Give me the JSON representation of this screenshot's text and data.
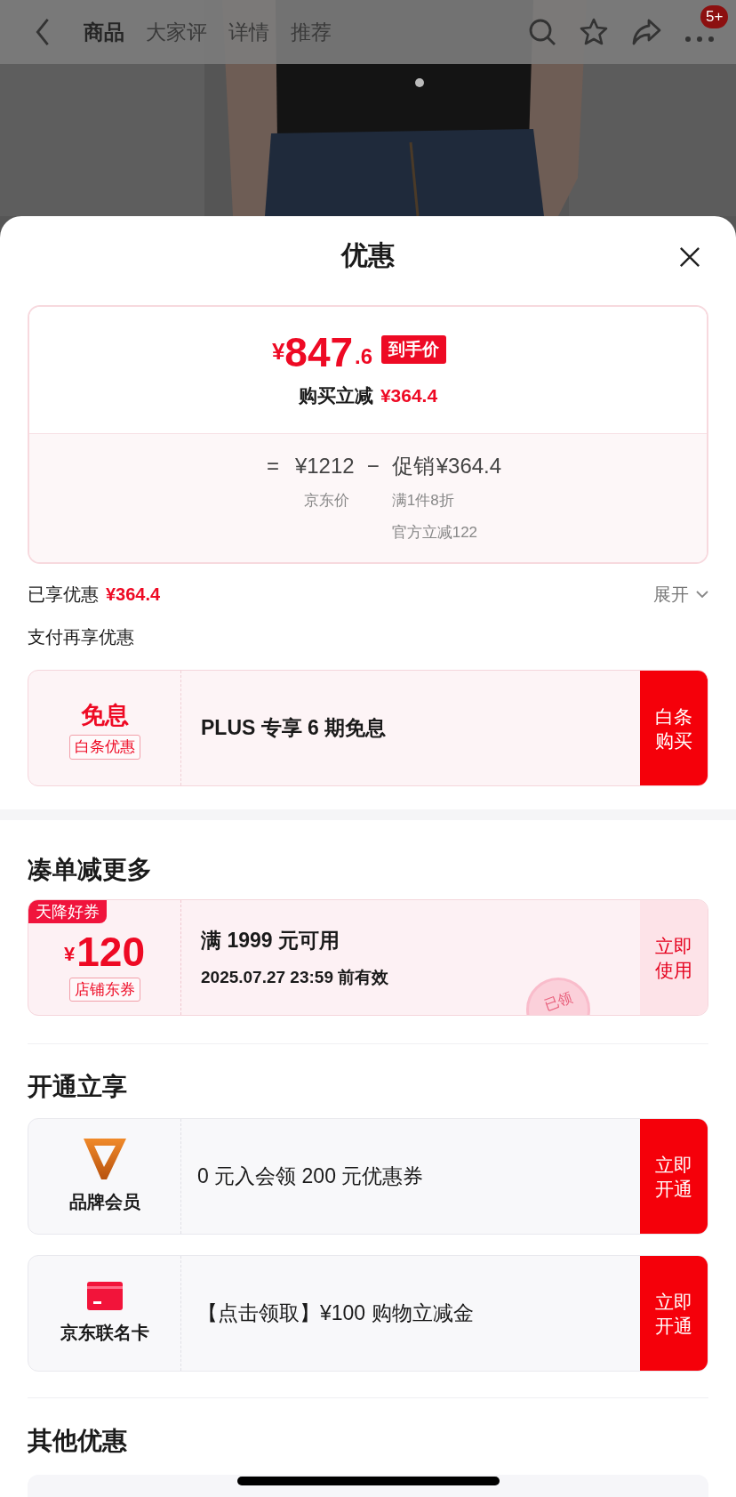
{
  "nav": {
    "tabs": [
      {
        "label": "商品",
        "selected": true
      },
      {
        "label": "大家评",
        "selected": false
      },
      {
        "label": "详情",
        "selected": false
      },
      {
        "label": "推荐",
        "selected": false
      }
    ],
    "badge": "5+"
  },
  "sheet": {
    "title": "优惠"
  },
  "price_card": {
    "currency": "¥",
    "integer": "847",
    "decimal": ".6",
    "tag": "到手价",
    "saving_label": "购买立减",
    "saving": "¥364.4",
    "equals": "=",
    "base_price": "¥1212",
    "base_label": "京东价",
    "minus": "−",
    "promo_label": "促销",
    "promo": "¥364.4",
    "promo_details": [
      "满1件8折",
      "官方立减122"
    ]
  },
  "enjoyed": {
    "label": "已享优惠",
    "amount": "¥364.4",
    "expand": "展开"
  },
  "pay_section": {
    "title": "支付再享优惠",
    "offer": {
      "headline": "免息",
      "tag": "白条优惠",
      "text": "PLUS 专享 6 期免息",
      "action": "白条购买"
    }
  },
  "coupon_section": {
    "title": "凑单减更多",
    "coupon": {
      "ribbon": "天降好券",
      "currency": "¥",
      "amount": "120",
      "tag": "店铺东券",
      "condition": "满 1999 元可用",
      "validity": "2025.07.27 23:59 前有效",
      "stamp": "已领",
      "action": "立即使用"
    }
  },
  "open_section": {
    "title": "开通立享",
    "offers": [
      {
        "kind": "brand",
        "name": "品牌会员",
        "text": "0 元入会领 200 元优惠券",
        "action": "立即开通"
      },
      {
        "kind": "card",
        "name": "京东联名卡",
        "text": "【点击领取】¥100 购物立减金",
        "action": "立即开通"
      }
    ]
  },
  "other_section": {
    "title": "其他优惠"
  }
}
